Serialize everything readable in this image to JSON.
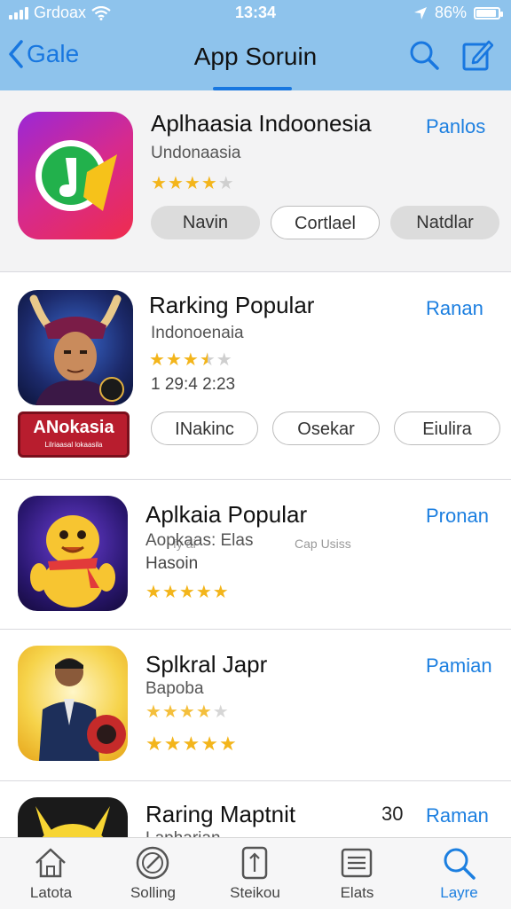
{
  "status_bar": {
    "carrier": "Grdoax",
    "time": "13:34",
    "battery": "86%"
  },
  "nav": {
    "back_label": "Gale",
    "title": "App Soruin"
  },
  "apps": [
    {
      "title": "Aplhaasia Indoonesia",
      "subtitle": "Undonaasia",
      "action": "Panlos",
      "rating": 4,
      "buttons": [
        "Navin",
        "Cortlael",
        "Natdlar"
      ]
    },
    {
      "title": "Rarking Popular",
      "subtitle": "Indonoenaia",
      "meta": "1 29:4 2:23",
      "action": "Ranan",
      "rating": 3.5,
      "badge_title": "ANokasia",
      "badge_small": "Lilriaasal lokaasila",
      "buttons": [
        "INakinc",
        "Osekar",
        "Eiulira"
      ],
      "faint_1": "fy ai",
      "faint_2": "Cap Usiss"
    },
    {
      "title": "Aplkaia Popular",
      "subtitle": "Aopkaas: Elas",
      "meta": "Hasoin",
      "action": "Pronan",
      "rating": 5
    },
    {
      "title": "Splkral Japr",
      "subtitle": "Bapoba",
      "action": "Pamian",
      "rating": 5
    },
    {
      "title": "Raring Maptnit",
      "subtitle": "Lapharian",
      "count": "30",
      "action": "Raman"
    }
  ],
  "tabs": [
    {
      "label": "Latota",
      "icon": "home-icon"
    },
    {
      "label": "Solling",
      "icon": "browse-icon"
    },
    {
      "label": "Steikou",
      "icon": "document-icon"
    },
    {
      "label": "Elats",
      "icon": "list-icon"
    },
    {
      "label": "Layre",
      "icon": "search-icon",
      "active": true
    }
  ],
  "colors": {
    "accent": "#1c7fe0",
    "nav_bg": "#8ec3ec",
    "star": "#f3b51b"
  }
}
